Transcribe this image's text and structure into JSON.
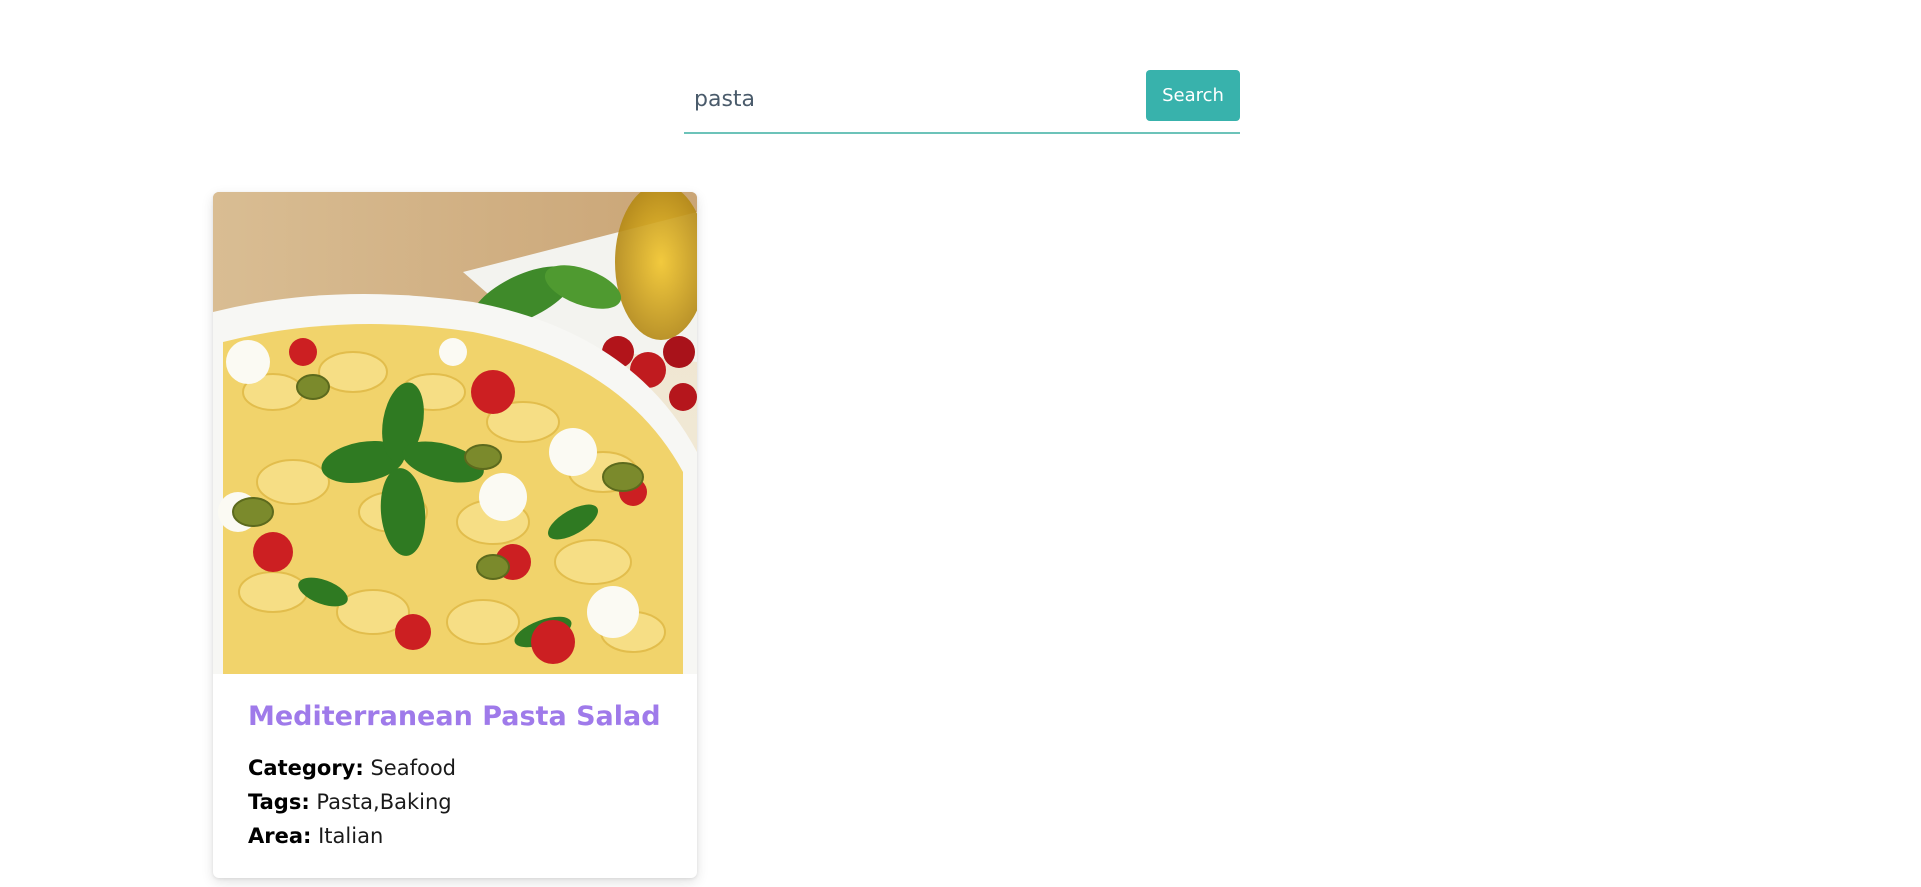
{
  "search": {
    "value": "pasta",
    "button_label": "Search"
  },
  "results": [
    {
      "title": "Mediterranean Pasta Salad",
      "category_label": "Category:",
      "category": "Seafood",
      "tags_label": "Tags:",
      "tags": "Pasta,Baking",
      "area_label": "Area:",
      "area": "Italian",
      "image_icon": "pasta-salad-photo"
    }
  ],
  "colors": {
    "accent": "#38b2ac",
    "title": "#9f7aea",
    "underline": "#6cc3b9"
  }
}
